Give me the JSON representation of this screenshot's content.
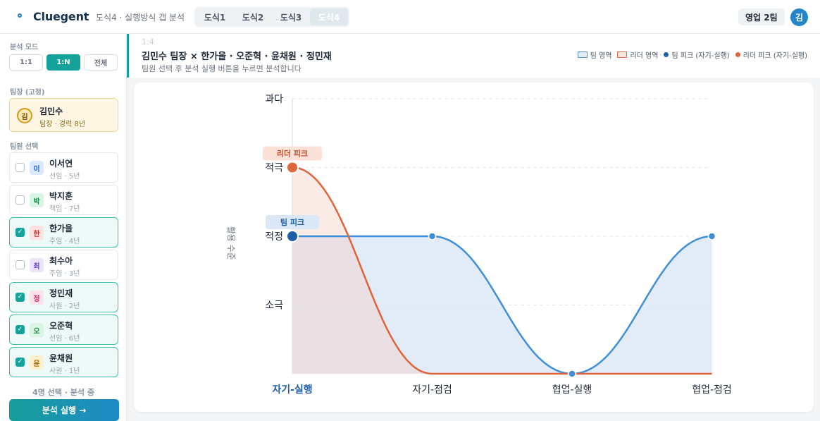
{
  "header": {
    "brand": "Cluegent",
    "subtitle": "도식4 · 실행방식 갭 분석",
    "tabs": [
      {
        "label": "도식1",
        "active": false
      },
      {
        "label": "도식2",
        "active": false
      },
      {
        "label": "도식3",
        "active": false
      },
      {
        "label": "도식4",
        "active": true
      }
    ],
    "team": "영업 2팀",
    "user_initial": "김"
  },
  "sidebar": {
    "mode_label": "분석 모드",
    "modes": [
      {
        "label": "1:1",
        "active": false
      },
      {
        "label": "1:N",
        "active": true
      },
      {
        "label": "전체",
        "active": false
      }
    ],
    "leader_label": "팀장 (고정)",
    "leader": {
      "initial": "김",
      "name": "김민수",
      "sub": "팀장 · 경력 8년"
    },
    "members_label": "팀원 선택",
    "members": [
      {
        "initial": "이",
        "name": "이서연",
        "sub": "선임 · 5년",
        "checked": false,
        "bg": "#dbe9ff",
        "fg": "#2a62c9"
      },
      {
        "initial": "박",
        "name": "박지훈",
        "sub": "책임 · 7년",
        "checked": false,
        "bg": "#daf5e4",
        "fg": "#1f8a4c"
      },
      {
        "initial": "한",
        "name": "한가을",
        "sub": "주임 · 4년",
        "checked": true,
        "bg": "#fde2e2",
        "fg": "#c53b3b"
      },
      {
        "initial": "최",
        "name": "최수아",
        "sub": "주임 · 3년",
        "checked": false,
        "bg": "#ece4fb",
        "fg": "#6b46c1"
      },
      {
        "initial": "정",
        "name": "정민재",
        "sub": "사원 · 2년",
        "checked": true,
        "bg": "#fde2ea",
        "fg": "#c5305e"
      },
      {
        "initial": "오",
        "name": "오준혁",
        "sub": "선임 · 6년",
        "checked": true,
        "bg": "#daf5e4",
        "fg": "#1f8a4c"
      },
      {
        "initial": "윤",
        "name": "윤채원",
        "sub": "사원 · 1년",
        "checked": true,
        "bg": "#fdf0cf",
        "fg": "#a86b00"
      }
    ],
    "selected_status": "4명 선택 · 분석 중",
    "run_label": "분석 실행 →"
  },
  "main": {
    "ratio": "1:4",
    "title": "김민수 팀장 × 한가을 · 오준혁 · 윤채원 · 정민재",
    "subtitle": "팀원 선택 후 분석 실행 버튼을 누르면 분석합니다",
    "legend": [
      {
        "label": "팀 영역",
        "kind": "square",
        "fill": "#e1edf8",
        "stroke": "#4a90d9"
      },
      {
        "label": "리더 영역",
        "kind": "square",
        "fill": "#fbe7e1",
        "stroke": "#e0643a"
      },
      {
        "label": "팀 피크 (자기-실행)",
        "kind": "dot",
        "color": "#1f5fa8"
      },
      {
        "label": "리더 피크 (자기-실행)",
        "kind": "dot",
        "color": "#e0643a"
      }
    ]
  },
  "chart_data": {
    "type": "area",
    "ylabel": "활용 수준",
    "y_levels": [
      "소극",
      "적정",
      "적극",
      "과다"
    ],
    "ylim": [
      0,
      4
    ],
    "categories": [
      "자기-실행",
      "자기-점검",
      "협업-실행",
      "협업-점검"
    ],
    "highlight_category": "자기-실행",
    "series": [
      {
        "name": "팀 영역",
        "values": [
          2,
          2,
          0,
          2
        ],
        "color": "#3f8fd8",
        "fill": "#dce9f7"
      },
      {
        "name": "리더 영역",
        "values": [
          3,
          0,
          0,
          0
        ],
        "color": "#e0643a",
        "fill": "#fbe4dd"
      }
    ],
    "annotations": [
      {
        "label": "리더 피크",
        "category": "자기-실행",
        "value": 3
      },
      {
        "label": "팀 피크",
        "category": "자기-실행",
        "value": 2
      }
    ],
    "grid": true,
    "legend_position": "top-right"
  }
}
